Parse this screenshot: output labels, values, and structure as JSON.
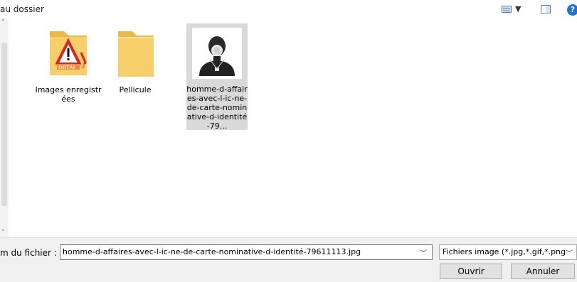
{
  "toolbar": {
    "new_folder_label": "au dossier",
    "help_label": "?"
  },
  "files": [
    {
      "name": "Images enregistrées",
      "icon": "folder-warning-icon"
    },
    {
      "name": "Pellicule",
      "icon": "folder-icon"
    },
    {
      "name": "homme-d-affaires-avec-l-ic-ne-de-carte-nominative-d-identité-79...",
      "icon": "person-badge-thumbnail",
      "selected": true
    }
  ],
  "footer": {
    "filename_label": "m du fichier :",
    "filename_value": "homme-d-affaires-avec-l-ic-ne-de-carte-nominative-d-identité-79611113.jpg",
    "filter_value": "Fichiers image (*.jpg,*.gif,*.png",
    "open_label": "Ouvrir",
    "cancel_label": "Annuler"
  },
  "colors": {
    "selection": "#d9d9d9",
    "folder": "#f7cf6a",
    "help_blue": "#1a73d8"
  }
}
